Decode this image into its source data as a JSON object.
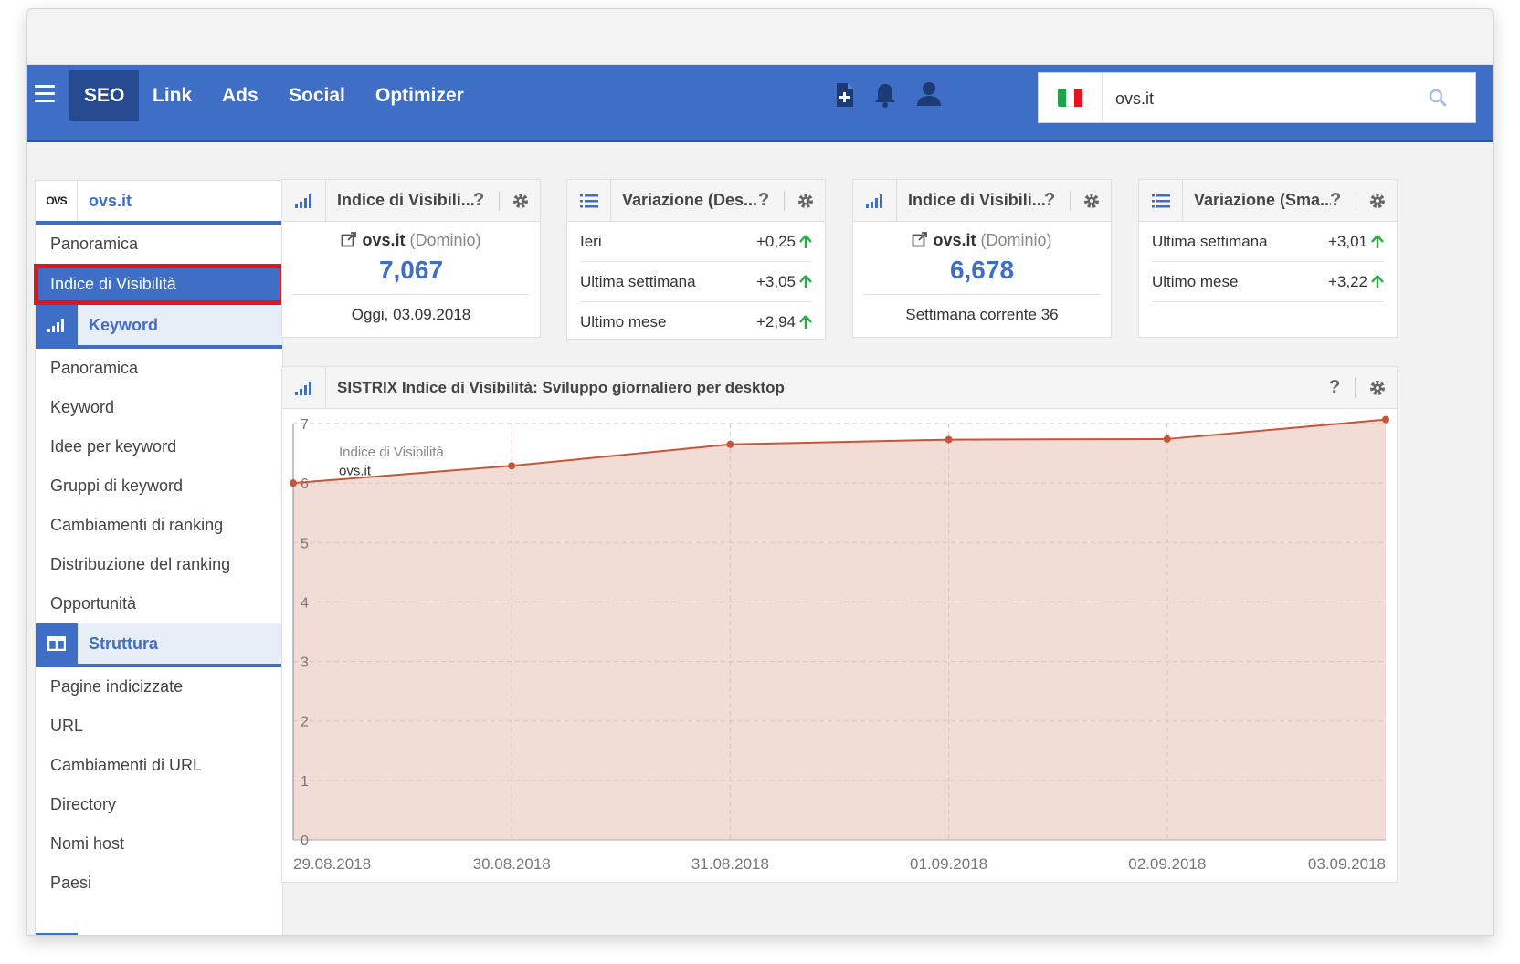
{
  "nav": {
    "items": [
      {
        "label": "SEO"
      },
      {
        "label": "Link"
      },
      {
        "label": "Ads"
      },
      {
        "label": "Social"
      },
      {
        "label": "Optimizer"
      }
    ],
    "search_value": "ovs.it",
    "flag": {
      "colors": [
        "#1ea34a",
        "#ffffff",
        "#e3141e"
      ]
    }
  },
  "sidebar": {
    "logo_text": "OVS",
    "domain": "ovs.it",
    "top_items": [
      {
        "label": "Panoramica"
      },
      {
        "label": "Indice di Visibilità"
      }
    ],
    "sections": [
      {
        "label": "Keyword",
        "icon": "bar-chart-icon",
        "items": [
          {
            "label": "Panoramica"
          },
          {
            "label": "Keyword"
          },
          {
            "label": "Idee per keyword"
          },
          {
            "label": "Gruppi di keyword"
          },
          {
            "label": "Cambiamenti di ranking"
          },
          {
            "label": "Distribuzione del ranking"
          },
          {
            "label": "Opportunità"
          }
        ]
      },
      {
        "label": "Struttura",
        "icon": "columns-icon",
        "items": [
          {
            "label": "Pagine indicizzate"
          },
          {
            "label": "URL"
          },
          {
            "label": "Cambiamenti di URL"
          },
          {
            "label": "Directory"
          },
          {
            "label": "Nomi host"
          },
          {
            "label": "Paesi"
          }
        ]
      }
    ]
  },
  "boxes": {
    "vis1": {
      "title": "Indice di Visibili...",
      "domain": "ovs.it",
      "domain_suffix": "(Dominio)",
      "value": "7,067",
      "footer": "Oggi, 03.09.2018"
    },
    "chg1": {
      "title": "Variazione (Des...",
      "rows": [
        {
          "label": "Ieri",
          "value": "+0,25"
        },
        {
          "label": "Ultima settimana",
          "value": "+3,05"
        },
        {
          "label": "Ultimo mese",
          "value": "+2,94"
        }
      ]
    },
    "vis2": {
      "title": "Indice di Visibili...",
      "domain": "ovs.it",
      "domain_suffix": "(Dominio)",
      "value": "6,678",
      "footer": "Settimana corrente 36"
    },
    "chg2": {
      "title": "Variazione (Sma...",
      "rows": [
        {
          "label": "Ultima settimana",
          "value": "+3,01"
        },
        {
          "label": "Ultimo mese",
          "value": "+3,22"
        }
      ]
    },
    "help_label": "?"
  },
  "chart_box": {
    "title": "SISTRIX Indice di Visibilità: Sviluppo giornaliero per desktop"
  },
  "chart_data": {
    "type": "area",
    "title": "SISTRIX Indice di Visibilità: Sviluppo giornaliero per desktop",
    "x": [
      "29.08.2018",
      "30.08.2018",
      "31.08.2018",
      "01.09.2018",
      "02.09.2018",
      "03.09.2018"
    ],
    "series": [
      {
        "name": "ovs.it",
        "values": [
          6.0,
          6.29,
          6.65,
          6.73,
          6.74,
          7.067
        ]
      }
    ],
    "legend_title": "Indice di Visibilità",
    "yticks": [
      0,
      1,
      2,
      3,
      4,
      5,
      6,
      7
    ],
    "ylim": [
      0,
      7
    ],
    "grid": true,
    "legend_position": "top-left",
    "line_color": "#c8553a",
    "fill_color": "#f1ddd6"
  },
  "colors": {
    "brand": "#3f6ec6",
    "positive": "#2ea84a",
    "highlight": "#e3141e"
  }
}
